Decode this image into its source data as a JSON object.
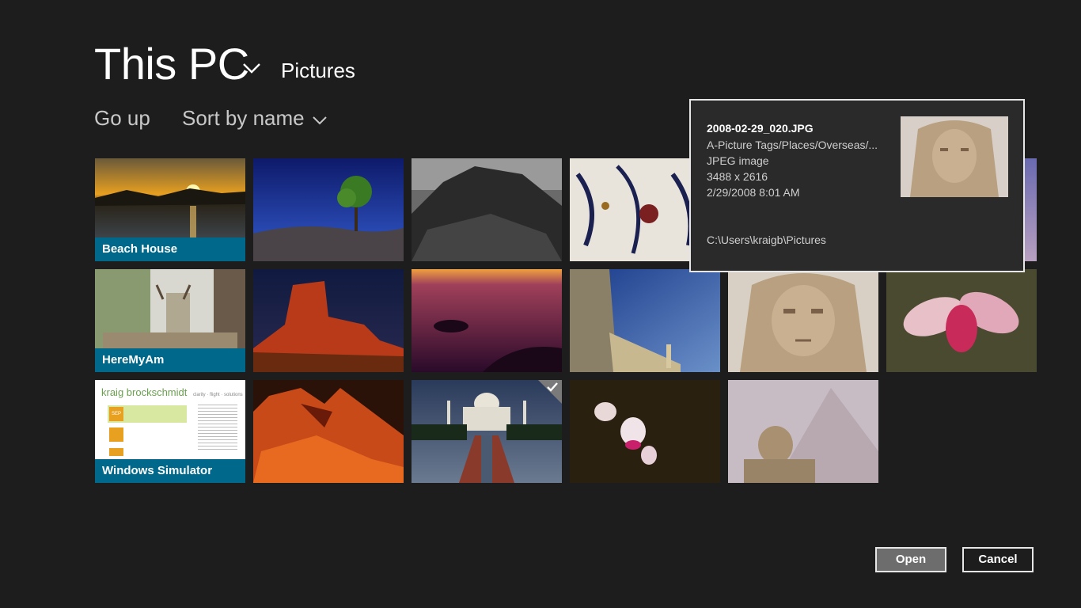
{
  "header": {
    "location": "This PC",
    "subfolder": "Pictures",
    "go_up": "Go up",
    "sort": "Sort by name"
  },
  "folders": [
    {
      "label": "Beach House"
    },
    {
      "label": "HereMyAm"
    },
    {
      "label": "Windows Simulator"
    }
  ],
  "simulator_thumb": {
    "title": "kraig brockschmidt",
    "tagline": "clarity · flight · solutions",
    "badge": "SEP"
  },
  "tooltip": {
    "filename": "2008-02-29_020.JPG",
    "tags": "A-Picture Tags/Places/Overseas/...",
    "type": "JPEG image",
    "dimensions": "3488 x 2616",
    "date": "2/29/2008 8:01 AM",
    "path": "C:\\Users\\kraigb\\Pictures"
  },
  "buttons": {
    "open": "Open",
    "cancel": "Cancel"
  },
  "colors": {
    "background": "#1d1d1d",
    "folder_label": "#00688b",
    "open_button": "#6d6d6d"
  }
}
